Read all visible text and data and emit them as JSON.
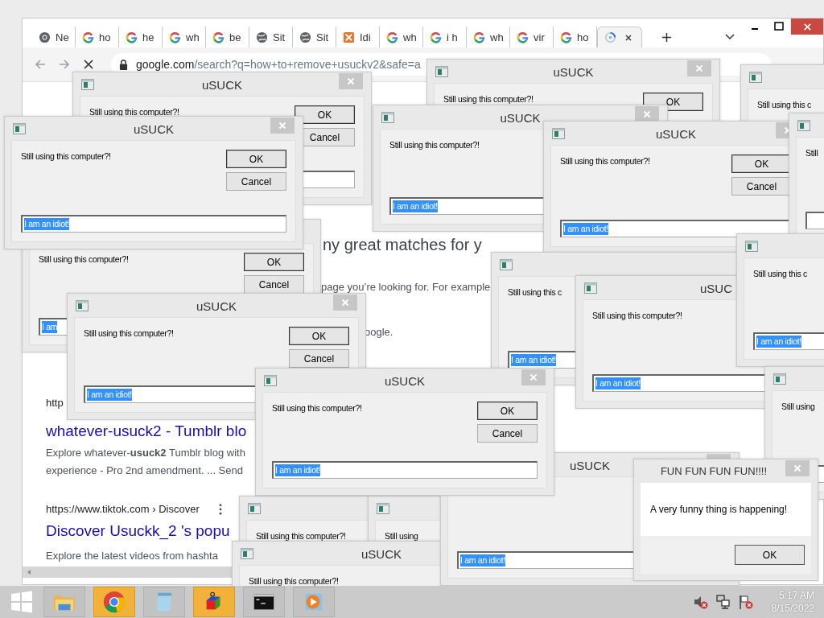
{
  "browser": {
    "tabs": [
      {
        "kind": "chrome",
        "label": "Ne",
        "selected": false
      },
      {
        "kind": "google",
        "label": "ho",
        "selected": false
      },
      {
        "kind": "google",
        "label": "he",
        "selected": false
      },
      {
        "kind": "google",
        "label": "wh",
        "selected": false
      },
      {
        "kind": "google",
        "label": "be",
        "selected": false
      },
      {
        "kind": "globe",
        "label": "Sit",
        "selected": false
      },
      {
        "kind": "globe",
        "label": "Sit",
        "selected": false
      },
      {
        "kind": "tile",
        "label": "Idi",
        "selected": false
      },
      {
        "kind": "google",
        "label": "wh",
        "selected": false
      },
      {
        "kind": "google",
        "label": "i h",
        "selected": false
      },
      {
        "kind": "google",
        "label": "wh",
        "selected": false
      },
      {
        "kind": "google",
        "label": "vir",
        "selected": false
      },
      {
        "kind": "google",
        "label": "ho",
        "selected": false
      },
      {
        "kind": "loading",
        "selected": true
      }
    ],
    "address_host": "google.com",
    "address_path": "/search?q=how+to+remove+usuckv2&safe=a",
    "page": [
      {
        "kind": "headline",
        "text": "ny great matches for y"
      },
      {
        "kind": "text",
        "text": "page you’re looking for. For example"
      },
      {
        "kind": "text",
        "text": "oogle."
      },
      {
        "kind": "url",
        "text": "http",
        "menu": false
      },
      {
        "kind": "link",
        "text": "whatever-usuck2 - Tumblr blo"
      },
      {
        "kind": "snippet",
        "text": "Explore whatever-**usuck2** Tumblr blog with"
      },
      {
        "kind": "snippet",
        "text": "experience - Pro 2nd amendment. ... Send"
      },
      {
        "kind": "url",
        "text": "https://www.tiktok.com › Discover",
        "menu": true
      },
      {
        "kind": "link",
        "text": "Discover Usuckk_2 's popu"
      },
      {
        "kind": "snippet",
        "text": "Explore the latest videos from hashta"
      }
    ]
  },
  "dialogs": [
    {
      "kind": "prompt",
      "message": "Still using this computer?!",
      "ok": "OK",
      "cancel": "Cancel",
      "input": "I am"
    },
    {
      "kind": "prompt",
      "title": "uSUCK",
      "message": "Still using this computer?!",
      "ok": "OK",
      "cancel": "Cancel"
    },
    {
      "kind": "prompt",
      "title": "uSUCK",
      "message": "Still using this computer?!",
      "ok": "OK"
    },
    {
      "kind": "prompt",
      "message": "Still using this c"
    },
    {
      "kind": "prompt",
      "title": "uSUCK",
      "message": "Still using this computer?!",
      "ok": "OK",
      "cancel": "Cancel",
      "input": "I am an idiot!"
    },
    {
      "kind": "prompt",
      "title": "uSUCK",
      "message": "Still using this computer?!",
      "input": "I am an idiot!"
    },
    {
      "kind": "prompt",
      "title": "uSUCK",
      "message": "Still using this computer?!",
      "ok": "OK",
      "cancel": "Cancel",
      "input": "I am an idiot!"
    },
    {
      "kind": "prompt",
      "message": "Still"
    },
    {
      "kind": "prompt",
      "title": "uSUCK",
      "message": "Still using this computer?!",
      "ok": "OK",
      "cancel": "Cancel",
      "input": "I am an idiot!"
    },
    {
      "kind": "prompt",
      "message": "Still using this c",
      "input": "I am an idiot!"
    },
    {
      "kind": "prompt",
      "title": "uSUC",
      "message": "Still using this computer?!",
      "input": "I am an idiot!"
    },
    {
      "kind": "prompt",
      "message": "Still using this c",
      "input": "I am an idiot!"
    },
    {
      "kind": "prompt",
      "message": "Still using"
    },
    {
      "kind": "prompt",
      "message": "Still using this computer?!"
    },
    {
      "kind": "prompt",
      "message": "Still using"
    },
    {
      "kind": "prompt",
      "title": "uSUCK",
      "message": "Still using this computer?!"
    },
    {
      "kind": "prompt",
      "title": "uSUCK",
      "input": "I am an idiot!"
    },
    {
      "kind": "prompt",
      "title": "uSUCK",
      "message": "Still using this computer?!",
      "ok": "OK",
      "cancel": "Cancel",
      "input": "I am an idiot!"
    },
    {
      "kind": "message",
      "title": "FUN FUN FUN FUN!!!!",
      "message": "A very funny thing is happening!",
      "ok": "OK"
    }
  ],
  "taskbar": {
    "apps": [
      {
        "kind": "folder",
        "highlighted": false
      },
      {
        "kind": "chrome",
        "highlighted": true
      },
      {
        "kind": "notepad",
        "highlighted": false
      },
      {
        "kind": "cube",
        "highlighted": true
      },
      {
        "kind": "console",
        "highlighted": false
      },
      {
        "kind": "player",
        "highlighted": false
      }
    ],
    "time": "5:17 AM",
    "date": "8/15/2022"
  }
}
